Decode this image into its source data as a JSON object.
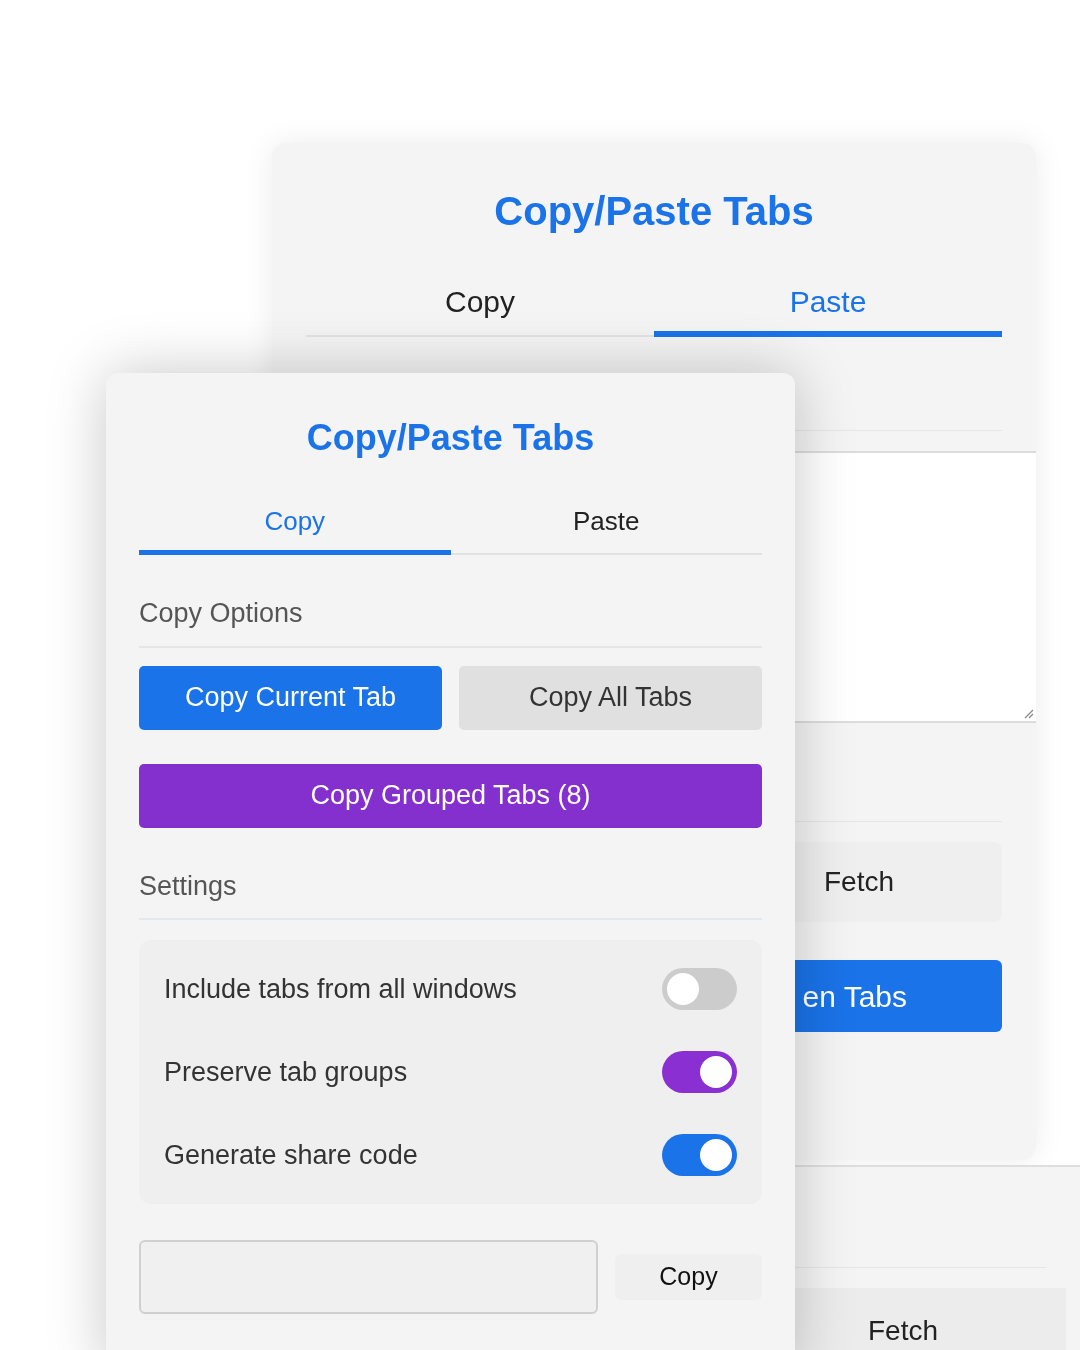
{
  "back_window": {
    "title": "Copy/Paste Tabs",
    "tabs": [
      {
        "label": "Copy",
        "selected": false
      },
      {
        "label": "Paste",
        "selected": true
      }
    ],
    "fetch_button": "Fetch",
    "open_button": "en Tabs"
  },
  "lower_window": {
    "fetch_button": "Fetch"
  },
  "front_window": {
    "title": "Copy/Paste Tabs",
    "tabs": [
      {
        "label": "Copy",
        "selected": true
      },
      {
        "label": "Paste",
        "selected": false
      }
    ],
    "copy_options": {
      "heading": "Copy Options",
      "buttons": [
        {
          "label": "Copy Current Tab",
          "kind": "primary"
        },
        {
          "label": "Copy All Tabs",
          "kind": "secondary"
        },
        {
          "label": "Copy Grouped Tabs (8)",
          "kind": "group"
        }
      ]
    },
    "settings": {
      "heading": "Settings",
      "items": [
        {
          "label": "Include tabs from all windows",
          "on": false
        },
        {
          "label": "Preserve tab groups",
          "on": true,
          "color": "#8a2fd1"
        },
        {
          "label": "Generate share code",
          "on": true,
          "color": "#1a73e8"
        }
      ]
    },
    "share_code": {
      "copy_button": "Copy"
    }
  }
}
